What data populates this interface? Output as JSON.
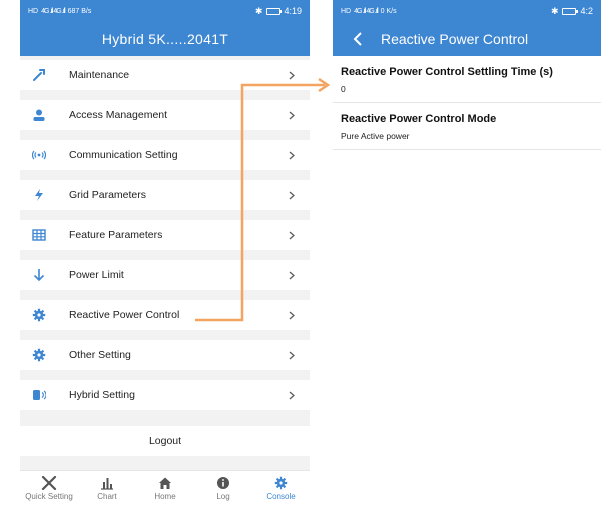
{
  "left": {
    "status": {
      "net1": "HD",
      "net2": "HD",
      "sig": "4G .ıll 4G .ıll",
      "speed": "687 B/s",
      "time": "4:19"
    },
    "title": "Hybrid 5K.....2041T",
    "menu": [
      {
        "label": "Maintenance",
        "icon": "tools-icon"
      },
      {
        "label": "Access Management",
        "icon": "user-icon"
      },
      {
        "label": "Communication Setting",
        "icon": "signal-icon"
      },
      {
        "label": "Grid Parameters",
        "icon": "lightning-icon"
      },
      {
        "label": "Feature Parameters",
        "icon": "grid-icon"
      },
      {
        "label": "Power Limit",
        "icon": "down-arrow-icon"
      },
      {
        "label": "Reactive Power Control",
        "icon": "gear-icon"
      },
      {
        "label": "Other Setting",
        "icon": "gear-icon"
      },
      {
        "label": "Hybrid Setting",
        "icon": "battery-icon"
      }
    ],
    "logout": "Logout",
    "nav": [
      {
        "label": "Quick Setting",
        "icon": "wrench-cross-icon",
        "active": false
      },
      {
        "label": "Chart",
        "icon": "chart-icon",
        "active": false
      },
      {
        "label": "Home",
        "icon": "home-icon",
        "active": false
      },
      {
        "label": "Log",
        "icon": "info-icon",
        "active": false
      },
      {
        "label": "Console",
        "icon": "gear-icon",
        "active": true
      }
    ]
  },
  "right": {
    "status": {
      "net1": "HD",
      "net2": "HD",
      "sig": "4G .ıll 4G .ıll",
      "speed": "0 K/s",
      "time": "4:2"
    },
    "title": "Reactive Power Control",
    "settings": [
      {
        "title": "Reactive Power Control Settling Time (s)",
        "value": "0"
      },
      {
        "title": "Reactive Power Control Mode",
        "value": "Pure Active power"
      }
    ]
  },
  "colors": {
    "accent": "#3d86d2",
    "highlight": "#f4a460"
  }
}
